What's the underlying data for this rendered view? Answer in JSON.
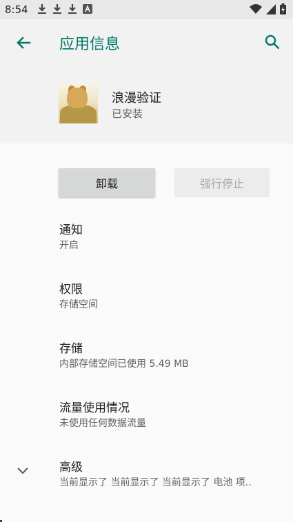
{
  "status_bar": {
    "time": "8:54",
    "left_icons": [
      "download-icon",
      "download-icon",
      "download-icon",
      "a-letter-icon"
    ],
    "right_icons": [
      "wifi-icon",
      "signal-icon",
      "battery-charging-icon"
    ]
  },
  "app_bar": {
    "title": "应用信息"
  },
  "app": {
    "name": "浪漫验证",
    "status": "已安装"
  },
  "buttons": {
    "uninstall": "卸载",
    "force_stop": "强行停止"
  },
  "settings": [
    {
      "title": "通知",
      "subtitle": "开启"
    },
    {
      "title": "权限",
      "subtitle": "存储空间"
    },
    {
      "title": "存储",
      "subtitle": "内部存储空间已使用 5.49 MB"
    },
    {
      "title": "流量使用情况",
      "subtitle": "未使用任何数据流量"
    },
    {
      "title": "高级",
      "subtitle": "当前显示了 当前显示了 当前显示了 电池 项.."
    }
  ],
  "colors": {
    "accent": "#00796b",
    "background": "#fafafa",
    "header_background": "#f2f2f2"
  }
}
